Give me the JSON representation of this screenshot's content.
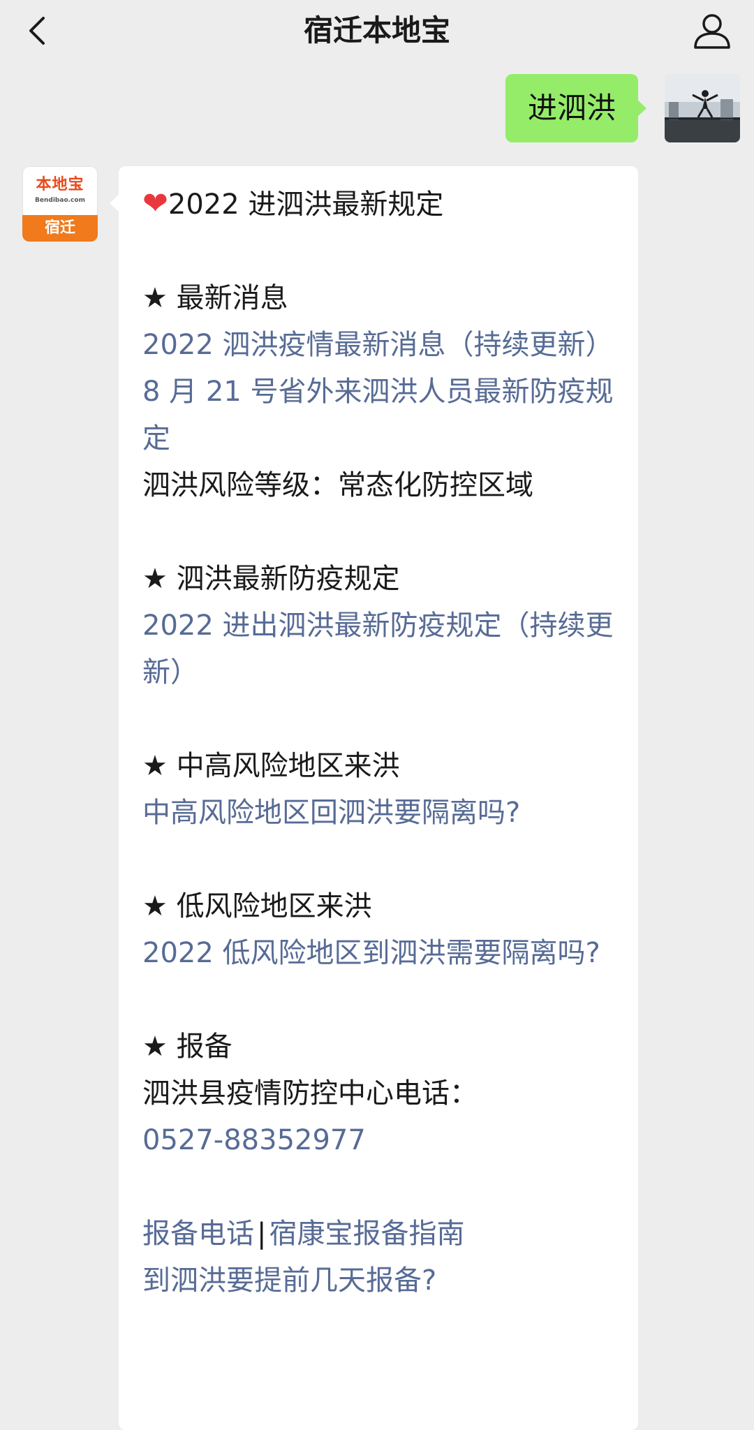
{
  "header": {
    "title": "宿迁本地宝"
  },
  "outgoing": {
    "text": "进泗洪"
  },
  "bot": {
    "logo_top": "本地宝",
    "logo_sub": "Bendibao.com",
    "logo_bottom": "宿迁"
  },
  "message": {
    "heart": "❤",
    "headline": "2022 进泗洪最新规定",
    "section_latest": {
      "title": "★ 最新消息",
      "link1": "2022 泗洪疫情最新消息（持续更新）",
      "link2": "8 月 21 号省外来泗洪人员最新防疫规定",
      "note": "泗洪风险等级：常态化防控区域"
    },
    "section_rules": {
      "title": "★ 泗洪最新防疫规定",
      "link1": "2022 进出泗洪最新防疫规定（持续更新）"
    },
    "section_high": {
      "title": "★ 中高风险地区来洪",
      "link1": "中高风险地区回泗洪要隔离吗?"
    },
    "section_low": {
      "title": "★ 低风险地区来洪",
      "link1": "2022 低风险地区到泗洪需要隔离吗?"
    },
    "section_report": {
      "title": "★ 报备",
      "label": "泗洪县疫情防控中心电话：",
      "phone": "0527-88352977",
      "link_phone": "报备电话",
      "separator": "|",
      "link_guide": "宿康宝报备指南",
      "link_days": "到泗洪要提前几天报备?"
    }
  }
}
